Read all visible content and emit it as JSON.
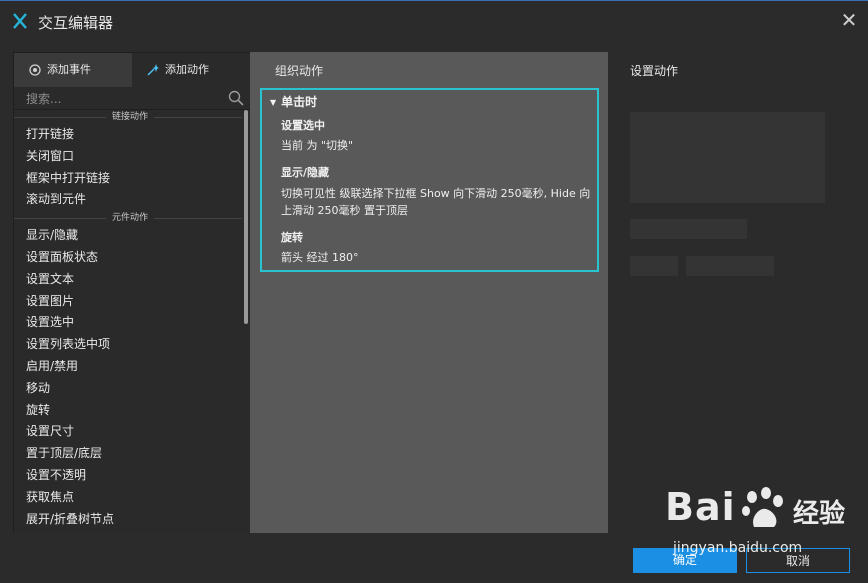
{
  "window": {
    "title": "交互编辑器",
    "close_icon": "close-icon"
  },
  "left": {
    "tabs": [
      {
        "label": "添加事件",
        "icon": "event-icon"
      },
      {
        "label": "添加动作",
        "icon": "sparkle-icon"
      }
    ],
    "search_placeholder": "搜索...",
    "sections": [
      {
        "title": "链接动作",
        "items": [
          "打开链接",
          "关闭窗口",
          "框架中打开链接",
          "滚动到元件"
        ]
      },
      {
        "title": "元件动作",
        "items": [
          "显示/隐藏",
          "设置面板状态",
          "设置文本",
          "设置图片",
          "设置选中",
          "设置列表选中项",
          "启用/禁用",
          "移动",
          "旋转",
          "设置尺寸",
          "置于顶层/底层",
          "设置不透明",
          "获取焦点",
          "展开/折叠树节点"
        ]
      }
    ]
  },
  "middle": {
    "header": "组织动作",
    "trigger": "单击时",
    "actions": [
      {
        "name": "设置选中",
        "desc": "当前 为 \"切换\""
      },
      {
        "name": "显示/隐藏",
        "desc": "切换可见性 级联选择下拉框 Show 向下滑动 250毫秒, Hide 向上滑动 250毫秒 置于顶层"
      },
      {
        "name": "旋转",
        "desc": "箭头 经过 180°"
      }
    ]
  },
  "right": {
    "header": "设置动作"
  },
  "footer": {
    "ok_label": "确定",
    "cancel_label": "取消"
  },
  "watermark": {
    "brand": "Bai",
    "brand_cn": "经验",
    "url": "jingyan.baidu.com"
  },
  "colors": {
    "accent": "#1b8fe3",
    "highlight": "#2ac3d0"
  }
}
